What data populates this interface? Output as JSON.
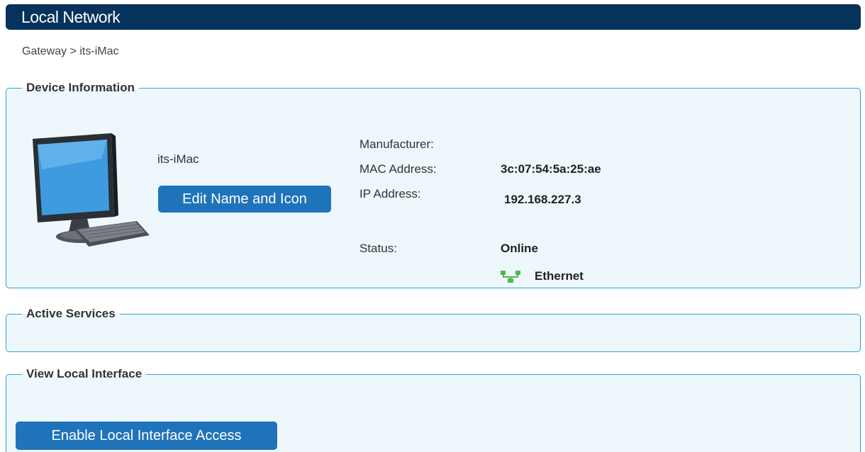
{
  "header": {
    "title": "Local Network"
  },
  "breadcrumb": {
    "text": "Gateway > its-iMac"
  },
  "device_info": {
    "legend": "Device Information",
    "device_name": "its-iMac",
    "edit_button_label": "Edit Name and Icon",
    "icon": "desktop-computer-icon",
    "manufacturer_label": "Manufacturer:",
    "manufacturer_value": "",
    "mac_label": "MAC Address:",
    "mac_value": "3c:07:54:5a:25:ae",
    "ip_label": "IP Address:",
    "ip_value": "192.168.227.3",
    "status_label": "Status:",
    "status_value": "Online",
    "connection_icon": "ethernet-icon",
    "connection_value": "Ethernet"
  },
  "active_services": {
    "legend": "Active Services"
  },
  "local_interface": {
    "legend": "View Local Interface",
    "enable_button_label": "Enable Local Interface Access"
  },
  "colors": {
    "header_bg": "#06325b",
    "panel_border": "#2ea3d9",
    "panel_bg": "#eef7fc",
    "button_bg": "#1f73bb",
    "ethernet_green": "#4db84a"
  }
}
